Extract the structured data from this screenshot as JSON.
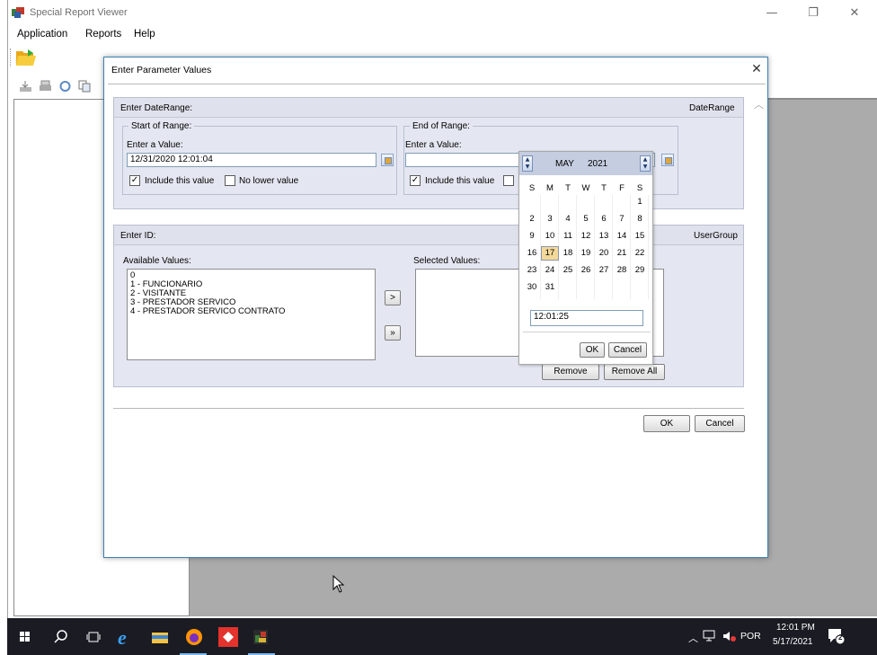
{
  "window": {
    "title": "Special Report Viewer",
    "minimize_glyph": "—",
    "restore_glyph": "❐",
    "close_glyph": "✕"
  },
  "menu": [
    "Application",
    "Reports",
    "Help"
  ],
  "dialog": {
    "title": "Enter Parameter Values",
    "close_glyph": "✕",
    "date_range": {
      "header": "Enter DateRange:",
      "param_name": "DateRange",
      "start": {
        "legend": "Start of Range:",
        "label": "Enter a Value:",
        "value": "12/31/2020 12:01:04",
        "include_label": "Include this value",
        "include_checked": true,
        "no_limit_label": "No lower value",
        "no_limit_checked": false
      },
      "end": {
        "legend": "End of Range:",
        "label": "Enter a Value:",
        "value": "",
        "include_label": "Include this value",
        "include_checked": true
      }
    },
    "id_param": {
      "header": "Enter ID:",
      "param_name": "UserGroup",
      "available_label": "Available Values:",
      "selected_label": "Selected Values:",
      "available_values": [
        "0",
        "1 - FUNCIONARIO",
        "2 - VISITANTE",
        "3 - PRESTADOR SERVICO",
        "4 - PRESTADOR SERVICO CONTRATO"
      ],
      "add_label": ">",
      "add_all_label": "»",
      "remove_label": "Remove",
      "remove_all_label": "Remove All"
    },
    "ok_label": "OK",
    "cancel_label": "Cancel"
  },
  "calendar": {
    "month": "MAY",
    "year": "2021",
    "weekdays": [
      "S",
      "M",
      "T",
      "W",
      "T",
      "F",
      "S"
    ],
    "weeks": [
      [
        "",
        "",
        "",
        "",
        "",
        "",
        "1"
      ],
      [
        "2",
        "3",
        "4",
        "5",
        "6",
        "7",
        "8"
      ],
      [
        "9",
        "10",
        "11",
        "12",
        "13",
        "14",
        "15"
      ],
      [
        "16",
        "17",
        "18",
        "19",
        "20",
        "21",
        "22"
      ],
      [
        "23",
        "24",
        "25",
        "26",
        "27",
        "28",
        "29"
      ],
      [
        "30",
        "31",
        "",
        "",
        "",
        "",
        ""
      ]
    ],
    "selected_day": "17",
    "time": "12:01:25",
    "ok_label": "OK",
    "cancel_label": "Cancel"
  },
  "taskbar": {
    "language": "POR",
    "time": "12:01 PM",
    "date": "5/17/2021",
    "notification_count": "2",
    "colors": {
      "background": "#1b1b24",
      "underline": "#76b9ed"
    }
  }
}
